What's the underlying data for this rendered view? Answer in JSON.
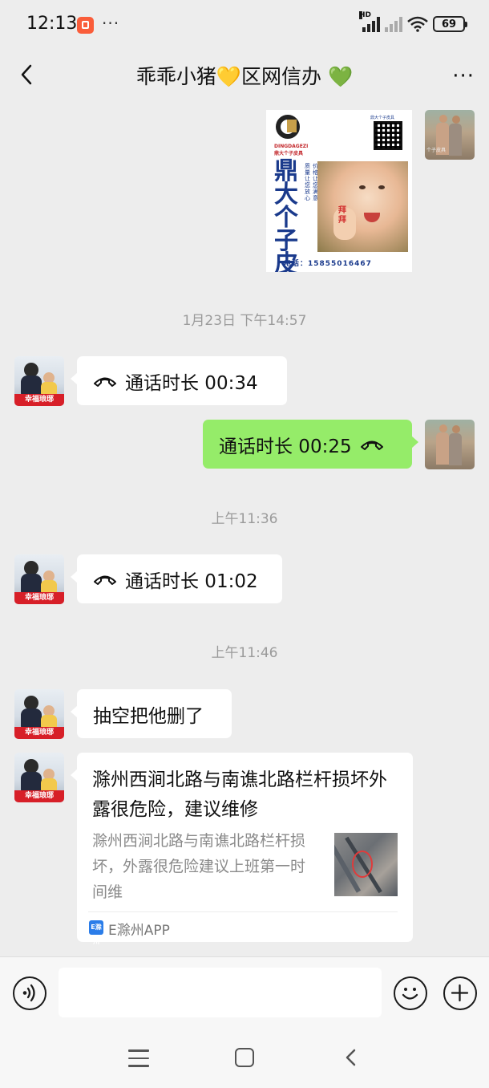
{
  "status_bar": {
    "time": "12:13",
    "dots": "···",
    "hd": "HD",
    "battery": "69"
  },
  "header": {
    "title": "乖乖小猪💛区网信办 💚",
    "more": "···"
  },
  "messages": [
    {
      "type": "image",
      "side": "right"
    },
    {
      "type": "timestamp",
      "text": "1月23日 下午14:57"
    },
    {
      "type": "call",
      "side": "left",
      "text": "通话时长 00:34"
    },
    {
      "type": "call",
      "side": "right",
      "text": "通话时长 00:25"
    },
    {
      "type": "timestamp",
      "text": "上午11:36"
    },
    {
      "type": "call",
      "side": "left",
      "text": "通话时长 01:02"
    },
    {
      "type": "timestamp",
      "text": "上午11:46"
    },
    {
      "type": "text",
      "side": "left",
      "text": "抽空把他删了"
    },
    {
      "type": "link",
      "side": "left"
    }
  ],
  "poster": {
    "brand": "DINGDAGEZI 鼎大个子皮具",
    "big_text": "鼎大个子皮具",
    "slogan_a": "质量让您放心",
    "slogan_b": "价格让您满意",
    "qr_caption": "鼎大个子皮具",
    "baby_tag": "拜拜",
    "phone": "电话：15855016467"
  },
  "avatar_girl_caption": "幸福琅琊",
  "avatar_men_caption": "个子皮具",
  "link_card": {
    "title": "滁州西涧北路与南谯北路栏杆损坏外露很危险，建议维修",
    "description": "滁州西涧北路与南谯北路栏杆损坏，外露很危险建议上班第一时间维",
    "source_icon": "E滁州",
    "source": "E滁州APP"
  },
  "input_bar": {
    "placeholder": ""
  },
  "icons": {
    "back": "chevron-left-icon",
    "more": "more-icon",
    "voice": "voice-icon",
    "emoji": "emoji-icon",
    "plus": "plus-icon",
    "call": "phone-hangup-icon"
  },
  "colors": {
    "chat_bg": "#ededed",
    "self_bubble": "#95ec69",
    "other_bubble": "#ffffff"
  }
}
